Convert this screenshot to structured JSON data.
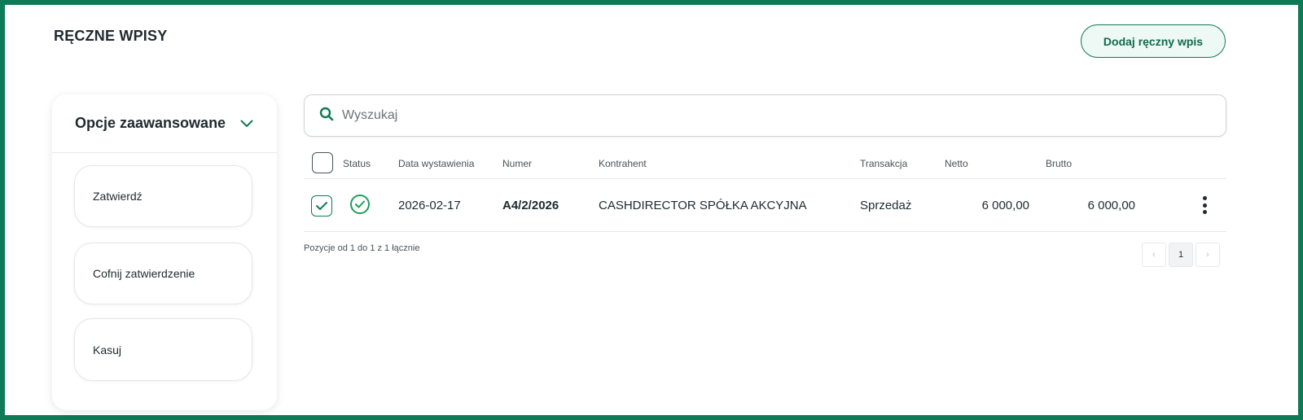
{
  "page": {
    "title": "RĘCZNE WPISY",
    "add_button_label": "Dodaj ręczny wpis"
  },
  "sidebar": {
    "header_label": "Opcje zaawansowane",
    "actions": [
      "Zatwierdź",
      "Cofnij zatwierdzenie",
      "Kasuj"
    ]
  },
  "search": {
    "placeholder": "Wyszukaj",
    "value": ""
  },
  "table": {
    "columns": {
      "status": "Status",
      "date": "Data wystawienia",
      "number": "Numer",
      "contractor": "Kontrahent",
      "transaction": "Transakcja",
      "net": "Netto",
      "gross": "Brutto"
    },
    "rows": [
      {
        "selected": true,
        "status": "approved",
        "date": "2026-02-17",
        "number": "A4/2/2026",
        "contractor": "CASHDIRECTOR SPÓŁKA AKCYJNA",
        "transaction": "Sprzedaż",
        "net": "6 000,00",
        "gross": "6 000,00"
      }
    ],
    "summary": "Pozycje od 1 do 1 z 1 łącznie"
  },
  "pagination": {
    "prev": "‹",
    "current": "1",
    "next": "›"
  },
  "colors": {
    "brand": "#0f7a56",
    "status_ok": "#1aa05a"
  },
  "icons": {
    "search": "search-icon",
    "chevron": "chevron-down-icon",
    "status": "check-circle-icon",
    "row_menu": "more-vertical-icon"
  }
}
